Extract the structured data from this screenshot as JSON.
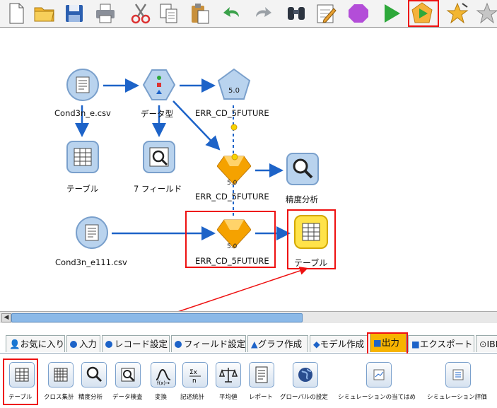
{
  "nodes": {
    "cond3n_e": "Cond3n_e.csv",
    "data_type": "データ型",
    "err_model_top": "ERR_CD_5FUTURE",
    "table1": "テーブル",
    "seven_fields": "7 フィールド",
    "err_nugget1": "ERR_CD_5FUTURE",
    "accuracy": "精度分析",
    "cond3n_e111": "Cond3n_e111.csv",
    "err_nugget2": "ERR_CD_5FUTURE",
    "table2": "テーブル",
    "c50_badge": "5.0"
  },
  "tabs": [
    "お気に入り",
    "入力",
    "レコード設定",
    "フィールド設定",
    "グラフ作成",
    "モデル作成",
    "出力",
    "エクスポート",
    "IBM"
  ],
  "palette": [
    "テーブル",
    "クロス集計",
    "精度分析",
    "データ検査",
    "変換",
    "記述統計",
    "平均値",
    "レポート",
    "グローバルの設定",
    "シミュレーションの当てはめ",
    "シミュレーション評価"
  ],
  "colors": {
    "highlight": "#e11111",
    "node_blue": "#1d63c8",
    "nugget": "#f5a200"
  }
}
